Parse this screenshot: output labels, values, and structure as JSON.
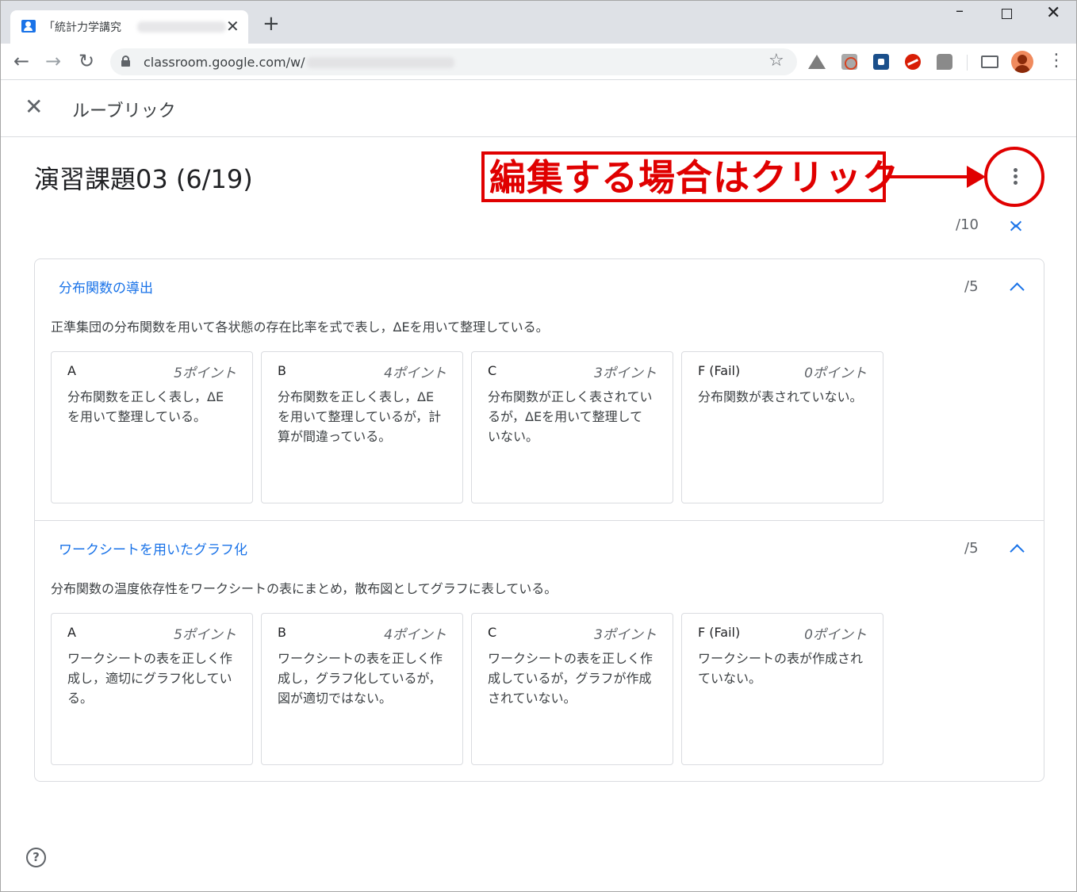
{
  "browser": {
    "tab_title": "「統計力学講究",
    "new_tab_label": "+",
    "url": "classroom.google.com/w/",
    "window_controls": {
      "minimize": "–",
      "close": "✕"
    }
  },
  "header": {
    "close_label": "✕",
    "page_label": "ルーブリック"
  },
  "rubric": {
    "title": "演習課題03 (6/19)",
    "total_score": "/10",
    "criteria": [
      {
        "title": "分布関数の導出",
        "score": "/5",
        "description": "正準集団の分布関数を用いて各状態の存在比率を式で表し，ΔEを用いて整理している。",
        "levels": [
          {
            "name": "A",
            "points": "5ポイント",
            "desc": "分布関数を正しく表し，ΔE を用いて整理している。"
          },
          {
            "name": "B",
            "points": "4ポイント",
            "desc": "分布関数を正しく表し，ΔE を用いて整理しているが，計算が間違っている。"
          },
          {
            "name": "C",
            "points": "3ポイント",
            "desc": "分布関数が正しく表されているが，ΔEを用いて整理していない。"
          },
          {
            "name": "F (Fail)",
            "points": "0ポイント",
            "desc": "分布関数が表されていない。"
          }
        ]
      },
      {
        "title": "ワークシートを用いたグラフ化",
        "score": "/5",
        "description": "分布関数の温度依存性をワークシートの表にまとめ，散布図としてグラフに表している。",
        "levels": [
          {
            "name": "A",
            "points": "5ポイント",
            "desc": "ワークシートの表を正しく作成し，適切にグラフ化している。"
          },
          {
            "name": "B",
            "points": "4ポイント",
            "desc": "ワークシートの表を正しく作成し，グラフ化しているが，図が適切ではない。"
          },
          {
            "name": "C",
            "points": "3ポイント",
            "desc": "ワークシートの表を正しく作成しているが，グラフが作成されていない。"
          },
          {
            "name": "F (Fail)",
            "points": "0ポイント",
            "desc": "ワークシートの表が作成されていない。"
          }
        ]
      }
    ]
  },
  "annotation": {
    "text": "編集する場合はクリック",
    "color": "#e00000"
  },
  "help_label": "?",
  "colors": {
    "accent": "#1a73e8",
    "text": "#202124",
    "muted": "#5f6368",
    "border": "#dadce0"
  }
}
